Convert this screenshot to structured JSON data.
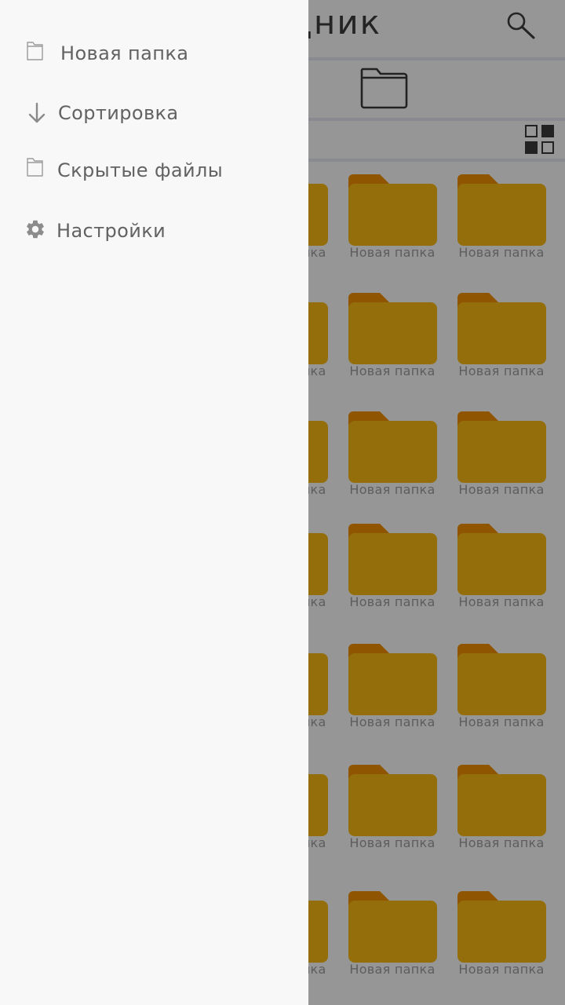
{
  "app": {
    "title": "Проводник",
    "icons": {
      "search": "search-icon",
      "folder": "folder-outline-icon",
      "view_toggle": "grid-view-icon"
    },
    "folder_color": "#f7b812",
    "folder_tab_color": "#f18e00",
    "grid_items": [
      {
        "label": "Новая папка"
      },
      {
        "label": "Новая папка"
      },
      {
        "label": "Новая папка"
      },
      {
        "label": "Новая папка"
      },
      {
        "label": "Новая папка"
      },
      {
        "label": "Новая папка"
      },
      {
        "label": "Новая папка"
      },
      {
        "label": "Новая папка"
      },
      {
        "label": "Новая папка"
      },
      {
        "label": "Новая папка"
      },
      {
        "label": "Новая папка"
      },
      {
        "label": "Новая папка"
      },
      {
        "label": "Новая папка"
      },
      {
        "label": "Новая папка"
      },
      {
        "label": "Новая папка"
      },
      {
        "label": "Новая папка"
      },
      {
        "label": "Новая папка"
      },
      {
        "label": "Новая папка"
      },
      {
        "label": "Новая папка"
      },
      {
        "label": "Новая папка"
      },
      {
        "label": "Новая папка"
      }
    ]
  },
  "drawer": {
    "items": [
      {
        "label": "Новая папка",
        "icon": "folder-outline-icon"
      },
      {
        "label": "Сортировка",
        "icon": "arrow-down-icon"
      },
      {
        "label": "Скрытые файлы",
        "icon": "folder-outline-icon"
      },
      {
        "label": "Настройки",
        "icon": "gear-icon"
      }
    ]
  }
}
